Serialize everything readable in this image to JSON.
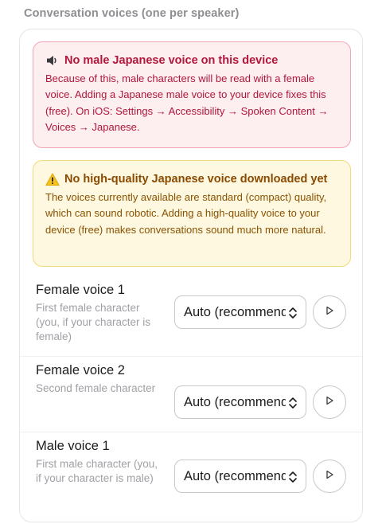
{
  "section": {
    "title": "Conversation voices (one per speaker)"
  },
  "alerts": {
    "no_male": {
      "title": "No male Japanese voice on this device",
      "body": "Because of this, male characters will be read with a female voice. Adding a Japanese male voice to your device fixes this (free). On iOS: Settings → Accessibility → Spoken Content → Voices → Japanese.",
      "icon": "speaker-low-icon",
      "color": "#b0173b"
    },
    "no_hq": {
      "title": "No high-quality Japanese voice downloaded yet",
      "body": "The voices currently available are standard (compact) quality, which can sound robotic. Adding a high-quality voice to your device (free) makes conversations sound much more natural.",
      "icon": "warning-icon",
      "color": "#8a4a00"
    }
  },
  "voices": [
    {
      "name": "Female voice 1",
      "desc": "First female character (you, if your character is female)",
      "selected": "Auto (recommended)"
    },
    {
      "name": "Female voice 2",
      "desc": "Second female character",
      "selected": "Auto (recommended)"
    },
    {
      "name": "Male voice 1",
      "desc": "First male character (you, if your character is male)",
      "selected": "Auto (recommended)"
    }
  ]
}
